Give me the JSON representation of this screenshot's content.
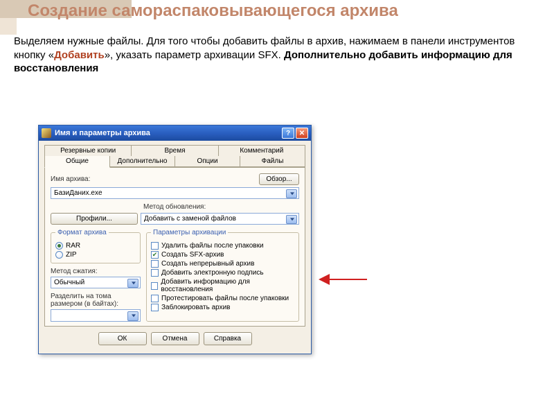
{
  "slide": {
    "title": "Создание самораспаковывающегося архива",
    "text_before": "Выделяем нужные файлы. Для того чтобы добавить файлы в архив, нажимаем в панели инструментов кнопку «",
    "accent_word": "Добавить",
    "text_after": "»,  указать параметр архивации SFX. ",
    "text_bold_tail": "Дополнительно добавить информацию для восстановления"
  },
  "dialog": {
    "title": "Имя и параметры архива",
    "help_symbol": "?",
    "close_symbol": "✕",
    "tabs_top": [
      "Резервные копии",
      "Время",
      "Комментарий"
    ],
    "tabs_bottom": [
      "Общие",
      "Дополнительно",
      "Опции",
      "Файлы"
    ],
    "active_tab": "Общие",
    "archive_name_label": "Имя архива:",
    "browse_btn": "Обзор...",
    "archive_name_value": "БазиДаних.exe",
    "profiles_btn": "Профили...",
    "update_method_label": "Метод обновления:",
    "update_method_value": "Добавить с заменой файлов",
    "format_legend": "Формат архива",
    "format_options": [
      {
        "label": "RAR",
        "selected": true
      },
      {
        "label": "ZIP",
        "selected": false
      }
    ],
    "compression_label": "Метод сжатия:",
    "compression_value": "Обычный",
    "split_label_1": "Разделить на тома",
    "split_label_2": "размером (в байтах):",
    "split_value": "",
    "params_legend": "Параметры архивации",
    "params": [
      {
        "label": "Удалить файлы после упаковки",
        "checked": false
      },
      {
        "label": "Создать SFX-архив",
        "checked": true
      },
      {
        "label": "Создать непрерывный архив",
        "checked": false
      },
      {
        "label": "Добавить электронную подпись",
        "checked": false
      },
      {
        "label": "Добавить информацию для восстановления",
        "checked": false
      },
      {
        "label": "Протестировать файлы после упаковки",
        "checked": false
      },
      {
        "label": "Заблокировать архив",
        "checked": false
      }
    ],
    "buttons": {
      "ok": "ОК",
      "cancel": "Отмена",
      "help": "Справка"
    }
  }
}
